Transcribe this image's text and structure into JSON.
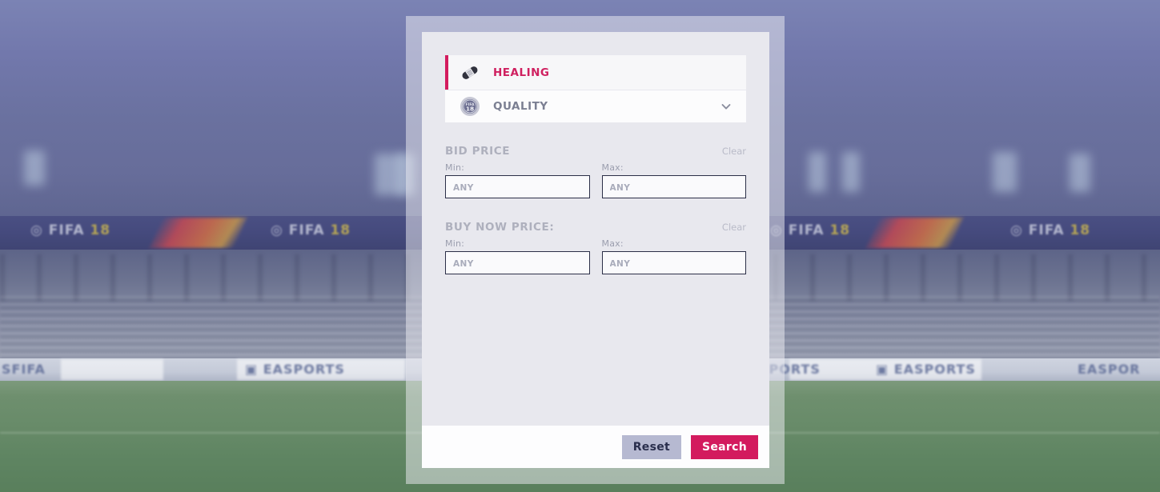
{
  "background": {
    "scene": "blurred-fifa-18-stadium",
    "banner_text_prefix": "FIFA",
    "banner_text_year": "18",
    "ad_text_left": "SFIFA",
    "ad_text_right": "EASPORTS",
    "pitch_color": "#688b69",
    "sky_color": "#7278ac"
  },
  "modal": {
    "categories": [
      {
        "label": "HEALING",
        "icon": "bandage-icon",
        "selected": true,
        "has_chevron": false
      },
      {
        "label": "QUALITY",
        "icon": "fifa18-badge-icon",
        "selected": false,
        "has_chevron": true,
        "chevron": "chevron-down-icon"
      }
    ],
    "price_filters": [
      {
        "title": "BID PRICE",
        "clear_label": "Clear",
        "min": {
          "label": "Min:",
          "value": "",
          "placeholder": "ANY"
        },
        "max": {
          "label": "Max:",
          "value": "",
          "placeholder": "ANY"
        }
      },
      {
        "title": "BUY NOW PRICE:",
        "clear_label": "Clear",
        "min": {
          "label": "Min:",
          "value": "",
          "placeholder": "ANY"
        },
        "max": {
          "label": "Max:",
          "value": "",
          "placeholder": "ANY"
        }
      }
    ],
    "footer": {
      "reset_label": "Reset",
      "search_label": "Search"
    }
  },
  "colors": {
    "accent": "#d31b5e",
    "selected_label": "#cf2060",
    "reset_bg": "#b6b9d1",
    "reset_text": "#2a2f4d",
    "panel_bg": "#e8e8ee",
    "row_bg": "#f5f5f7"
  }
}
